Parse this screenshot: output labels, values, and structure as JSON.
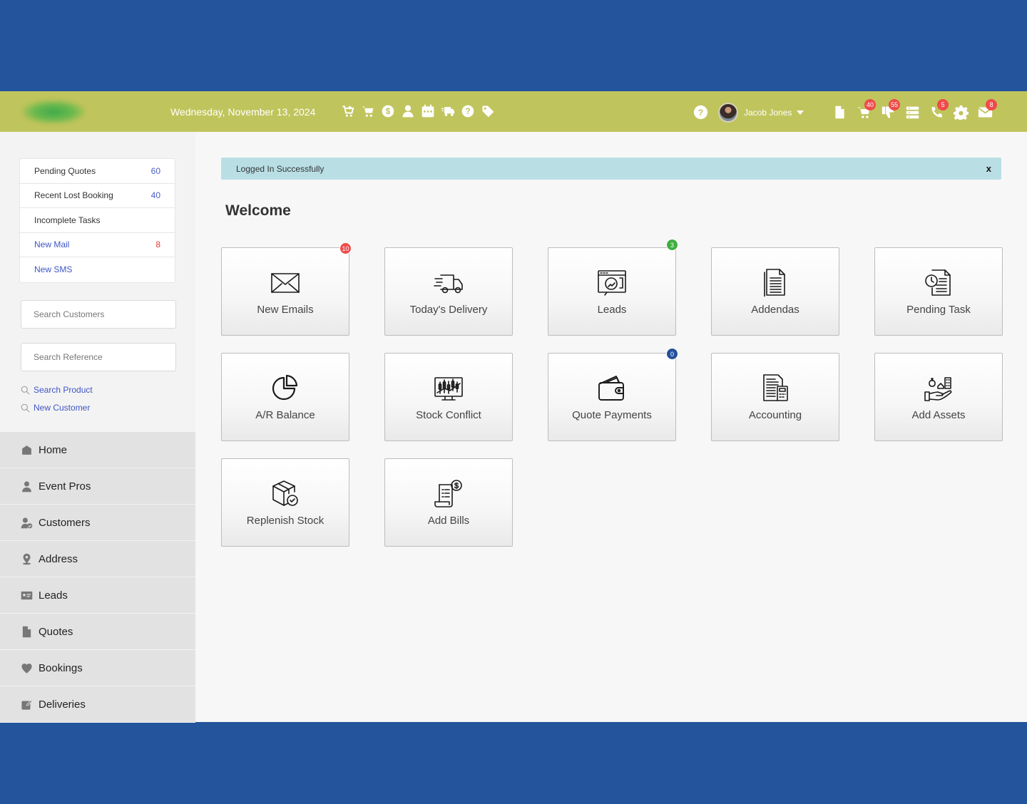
{
  "header": {
    "date": "Wednesday, November 13, 2024",
    "quick_icons": [
      "cart-plus-icon",
      "cart-icon",
      "dollar-icon",
      "user-icon",
      "calendar-icon",
      "truck-icon",
      "help-icon",
      "tag-icon"
    ],
    "user_name": "Jacob Jones",
    "right_icons": [
      {
        "name": "document-icon",
        "badge": null
      },
      {
        "name": "cart-icon",
        "badge": "40"
      },
      {
        "name": "thumbs-down-icon",
        "badge": "55"
      },
      {
        "name": "list-icon",
        "badge": null
      },
      {
        "name": "phone-icon",
        "badge": "5"
      },
      {
        "name": "gear-icon",
        "badge": null
      },
      {
        "name": "mail-icon",
        "badge": "8"
      }
    ]
  },
  "summary": {
    "pending_quotes": {
      "label": "Pending Quotes",
      "count": "60"
    },
    "recent_lost": {
      "label": "Recent Lost Booking",
      "count": "40"
    },
    "incomplete_tasks": {
      "label": "Incomplete Tasks"
    },
    "new_mail": {
      "label": "New Mail",
      "count": "8"
    },
    "new_sms": {
      "label": "New SMS"
    }
  },
  "search": {
    "customers_placeholder": "Search Customers",
    "reference_placeholder": "Search Reference",
    "search_product": "Search Product",
    "new_customer": "New Customer"
  },
  "nav": {
    "home": "Home",
    "event_pros": "Event Pros",
    "customers": "Customers",
    "address": "Address",
    "leads": "Leads",
    "quotes": "Quotes",
    "bookings": "Bookings",
    "deliveries": "Deliveries"
  },
  "alert": {
    "text": "Logged In Successfully",
    "close": "x"
  },
  "welcome": "Welcome",
  "tiles": {
    "new_emails": {
      "label": "New Emails",
      "badge": "10",
      "badge_color": "#ef4b4b"
    },
    "todays_delivery": {
      "label": "Today's Delivery"
    },
    "leads": {
      "label": "Leads",
      "badge": "3",
      "badge_color": "#3fae3f"
    },
    "addendas": {
      "label": "Addendas"
    },
    "pending_task": {
      "label": "Pending Task"
    },
    "ar_balance": {
      "label": "A/R Balance"
    },
    "stock_conflict": {
      "label": "Stock Conflict"
    },
    "quote_payments": {
      "label": "Quote Payments",
      "badge": "0",
      "badge_color": "#24509c"
    },
    "accounting": {
      "label": "Accounting"
    },
    "add_assets": {
      "label": "Add Assets"
    },
    "replenish_stock": {
      "label": "Replenish Stock"
    },
    "add_bills": {
      "label": "Add Bills"
    }
  }
}
